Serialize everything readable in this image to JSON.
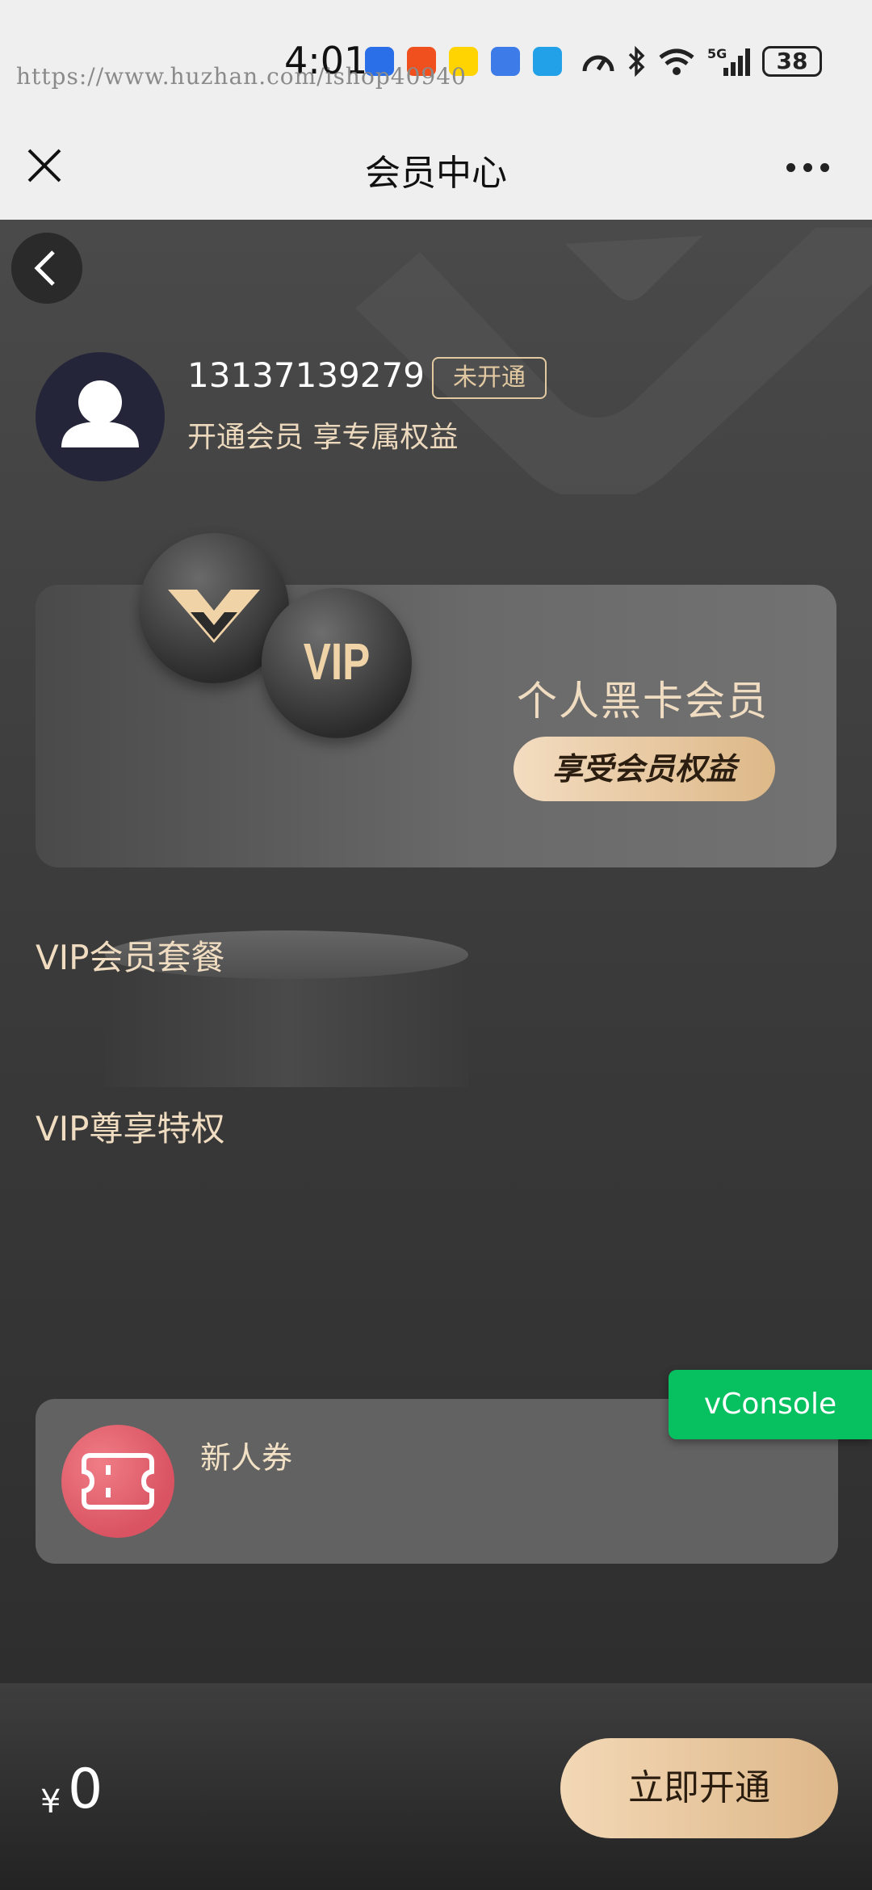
{
  "status_bar": {
    "time": "4:01",
    "watermark": "https://www.huzhan.com/ishop40940",
    "battery": "38",
    "network": "5G"
  },
  "nav": {
    "title": "会员中心"
  },
  "profile": {
    "phone": "13137139279",
    "status_badge": "未开通",
    "subtitle": "开通会员 享专属权益"
  },
  "banner": {
    "orb_text": "VIP",
    "title": "个人黑卡会员",
    "cta": "享受会员权益"
  },
  "sections": {
    "packages_title": "VIP会员套餐",
    "privileges_title": "VIP尊享特权"
  },
  "privileges": [
    {
      "label": "新人券",
      "icon": "ticket-icon"
    }
  ],
  "vconsole": "vConsole",
  "bottom": {
    "currency": "¥",
    "price": "0",
    "open_button": "立即开通"
  },
  "colors": {
    "gold": "#f0dcc0",
    "accent_green": "#07c160",
    "coupon_red": "#e0606c"
  }
}
